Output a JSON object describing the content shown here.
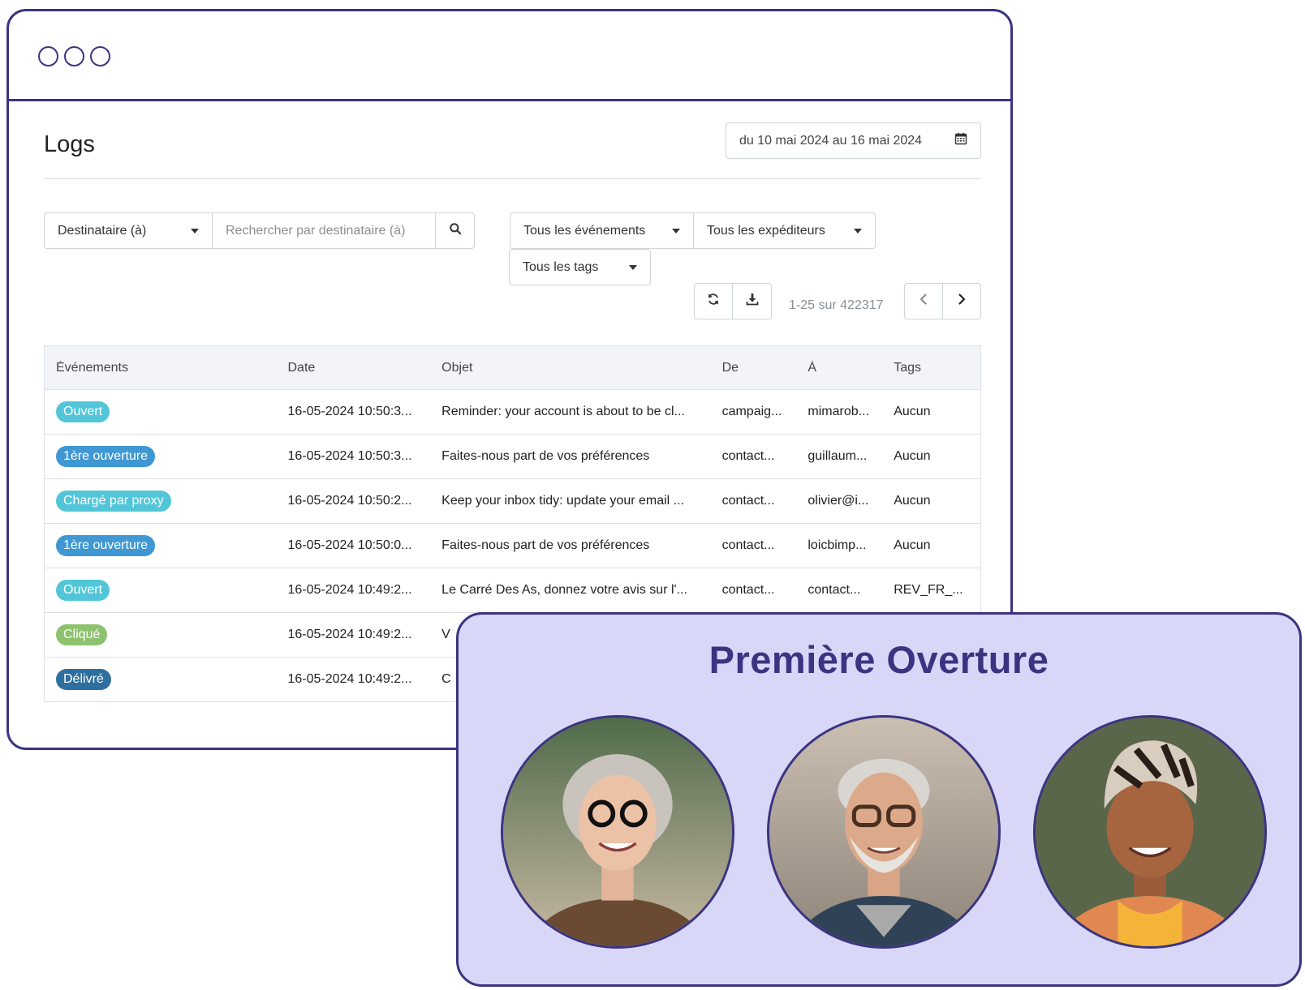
{
  "page": {
    "title": "Logs",
    "date_range": "du 10 mai 2024 au 16 mai 2024"
  },
  "filters": {
    "recipient_select": "Destinataire (à)",
    "search_placeholder": "Rechercher par destinataire (à)",
    "events_select": "Tous les événements",
    "senders_select": "Tous les expéditeurs",
    "tags_select": "Tous les tags"
  },
  "pagination": {
    "range_text": "1-25 sur 422317"
  },
  "table": {
    "headers": [
      "Événements",
      "Date",
      "Objet",
      "De",
      "À",
      "Tags"
    ],
    "rows": [
      {
        "event": "Ouvert",
        "color": "#52c6d8",
        "date": "16-05-2024 10:50:3...",
        "subject": "Reminder: your account is about to be cl...",
        "from": "campaig...",
        "to": "mimarob...",
        "tags": "Aucun"
      },
      {
        "event": "1ère ouverture",
        "color": "#3f97d3",
        "date": "16-05-2024 10:50:3...",
        "subject": "Faites-nous part de vos préférences",
        "from": "contact...",
        "to": "guillaum...",
        "tags": "Aucun"
      },
      {
        "event": "Chargé par proxy",
        "color": "#52c6d8",
        "date": "16-05-2024 10:50:2...",
        "subject": "Keep your inbox tidy: update your email ...",
        "from": "contact...",
        "to": "olivier@i...",
        "tags": "Aucun"
      },
      {
        "event": "1ère ouverture",
        "color": "#3f97d3",
        "date": "16-05-2024 10:50:0...",
        "subject": "Faites-nous part de vos préférences",
        "from": "contact...",
        "to": "loicbimp...",
        "tags": "Aucun"
      },
      {
        "event": "Ouvert",
        "color": "#52c6d8",
        "date": "16-05-2024 10:49:2...",
        "subject": "Le Carré Des As, donnez votre avis sur l'...",
        "from": "contact...",
        "to": "contact...",
        "tags": "REV_FR_..."
      },
      {
        "event": "Cliqué",
        "color": "#8dc26f",
        "date": "16-05-2024 10:49:2...",
        "subject": "V",
        "from": "",
        "to": "",
        "tags": ""
      },
      {
        "event": "Délivré",
        "color": "#2f6f9f",
        "date": "16-05-2024 10:49:2...",
        "subject": "C",
        "from": "",
        "to": "",
        "tags": ""
      }
    ]
  },
  "overlay": {
    "title": "Première Overture"
  },
  "colors": {
    "brand": "#3b3480",
    "card_bg": "#d9d7f8"
  },
  "icons": {
    "calendar": "calendar-icon",
    "search": "search-icon",
    "refresh": "refresh-icon",
    "download": "download-icon",
    "prev": "chevron-left-icon",
    "next": "chevron-right-icon"
  }
}
